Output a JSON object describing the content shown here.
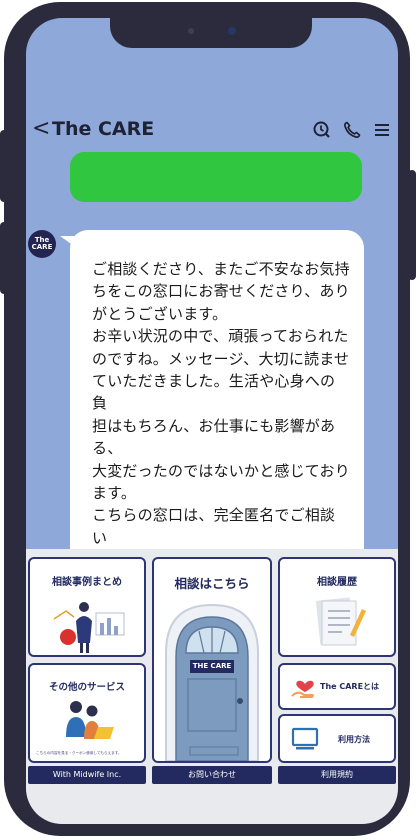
{
  "chat": {
    "title": "The CARE",
    "back_glyph": "<",
    "avatar_text": "The CARE",
    "message": "ご相談くださり、またご不安なお気持\nちをこの窓口にお寄せくださり、あり\nがとうございます。\nお辛い状況の中で、頑張っておられた\nのですね。メッセージ、大切に読ませ\nていただきました。生活や心身への負\n担はもちろん、お仕事にも影響がある、\n大変だったのではないかと感じており\nます。\nこちらの窓口は、完全匿名でご相談い\nただけますので、安心してお気持ちの\nままにお伝えくださいね。\n\nお伝えいただいた内容から、いくつか\n質問をさせてください。\nこういった心や体の状況になられたの"
  },
  "header_icons": [
    "clock-icon",
    "phone-icon",
    "menu-icon"
  ],
  "menu": {
    "case_examples": "相談事例まとめ",
    "consult_here": "相談はこちら",
    "door_sign": "THE CARE",
    "history": "相談履歴",
    "other_services": "その他のサービス",
    "about": "The CAREとは",
    "usage": "利用方法",
    "fine_print": "こちらの内容を見る・クーポン使用してもらえます。",
    "footer": [
      "With Midwife Inc.",
      "お問い合わせ",
      "利用規約"
    ]
  },
  "colors": {
    "screen_bg": "#8ea9d9",
    "user_bubble": "#31c640",
    "navy": "#232a5f",
    "phone_frame": "#2c2a3d"
  }
}
